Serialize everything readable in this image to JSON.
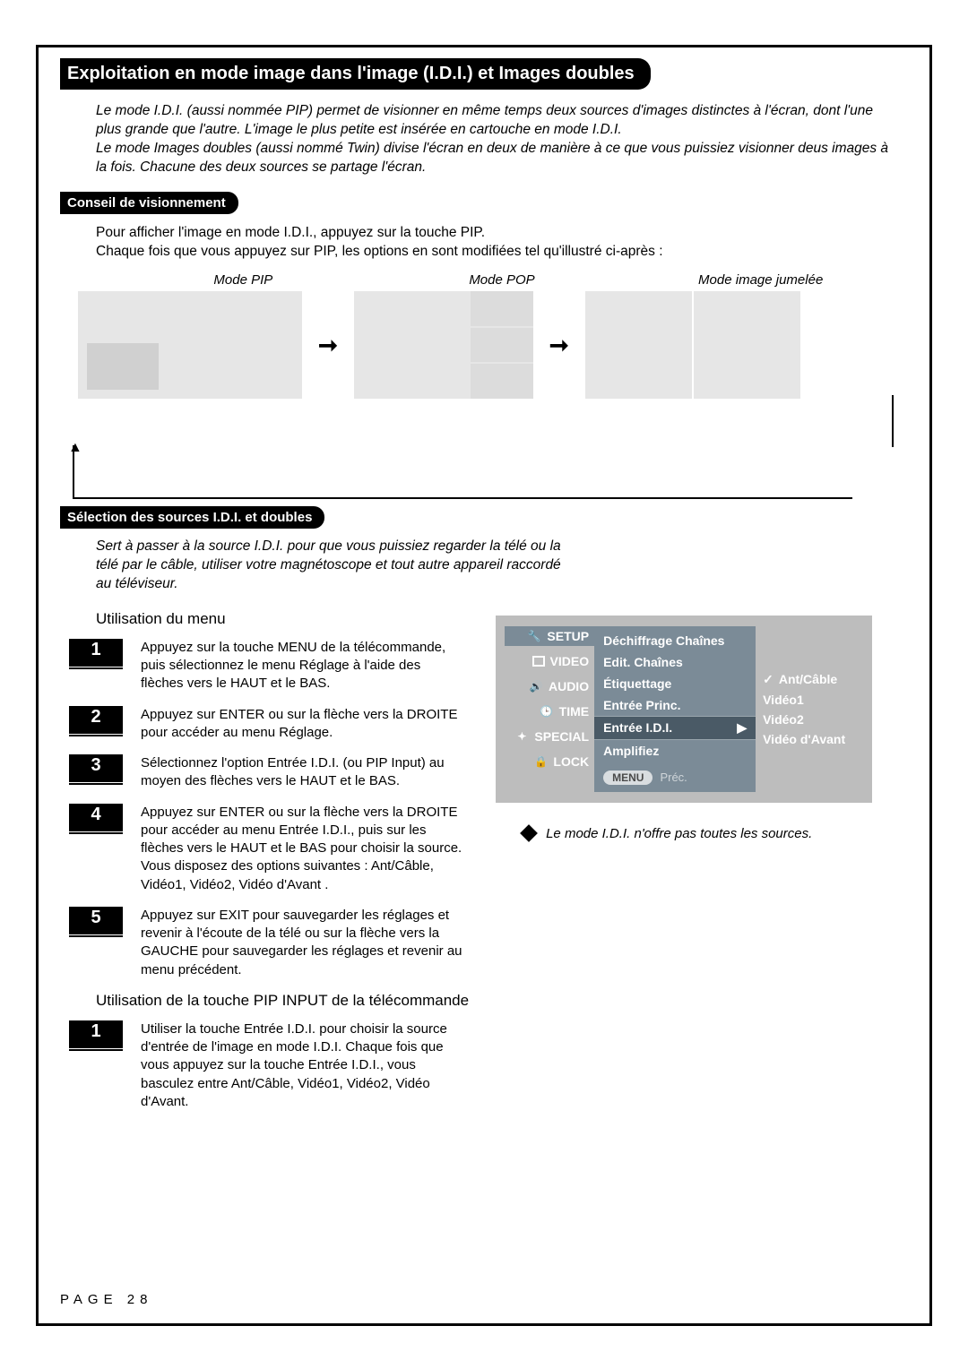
{
  "title": "Exploitation en mode image dans l'image (I.D.I.) et Images doubles",
  "intro": "Le mode I.D.I. (aussi nommée PIP) permet de visionner en même temps deux sources d'images distinctes à l'écran, dont l'une plus grande que l'autre. L'image le plus petite est insérée en cartouche en mode I.D.I.\nLe mode Images doubles (aussi nommé Twin) divise l'écran en deux de manière à ce que vous puissiez visionner deus images à la fois. Chacune des deux sources se partage l'écran.",
  "section_conseil": "Conseil de visionnement",
  "conseil_text": "Pour afficher l'image en mode I.D.I., appuyez sur la touche PIP.\nChaque fois que vous appuyez sur PIP, les options en sont modifiées tel qu'illustré ci-après :",
  "modes": {
    "pip": "Mode PIP",
    "pop": "Mode POP",
    "twin": "Mode image jumelée"
  },
  "section_selection": "Sélection des sources I.D.I. et doubles",
  "selection_intro": "Sert à passer à la source I.D.I. pour que vous puissiez regarder la télé ou la télé par le câble, utiliser votre magnétoscope  et tout autre appareil raccordé au téléviseur.",
  "util_menu_heading": "Utilisation du menu",
  "steps_menu": [
    "Appuyez sur la touche MENU de la télécommande, puis sélectionnez le menu Réglage à l'aide des flèches vers le HAUT et le BAS.",
    "Appuyez sur ENTER ou sur la flèche vers la DROITE pour accéder au menu Réglage.",
    "Sélectionnez l'option Entrée I.D.I. (ou PIP Input) au moyen des flèches vers le HAUT et le BAS.",
    "Appuyez sur ENTER ou sur la flèche vers la DROITE pour accéder au menu Entrée I.D.I., puis sur les flèches vers le HAUT et le BAS pour choisir la source. Vous disposez des options suivantes : Ant/Câble, Vidéo1, Vidéo2, Vidéo d'Avant .",
    "Appuyez sur EXIT pour sauvegarder les réglages et revenir à l'écoute de la télé ou sur la flèche vers la GAUCHE pour sauvegarder les réglages et revenir au menu précédent."
  ],
  "util_pip_heading": "Utilisation de la touche PIP INPUT de la télécommande",
  "steps_pip": [
    "Utiliser la touche Entrée I.D.I. pour choisir la source d'entrée de l'image en mode I.D.I. Chaque fois que vous appuyez sur la touche Entrée I.D.I., vous basculez entre Ant/Câble, Vidéo1, Vidéo2, Vidéo d'Avant."
  ],
  "osd": {
    "tabs": [
      "SETUP",
      "VIDEO",
      "AUDIO",
      "TIME",
      "SPECIAL",
      "LOCK"
    ],
    "items": [
      "Déchiffrage Chaînes",
      "Edit. Chaînes",
      "Étiquettage",
      "Entrée Princ.",
      "Entrée I.D.I.",
      "Amplifiez"
    ],
    "selected_item": "Entrée I.D.I.",
    "options": [
      "Ant/Câble",
      "Vidéo1",
      "Vidéo2",
      "Vidéo d'Avant"
    ],
    "selected_option": "Ant/Câble",
    "footer_menu": "MENU",
    "footer_prev": "Préc."
  },
  "note": "Le mode I.D.I. n'offre pas toutes les sources.",
  "page_label": "PAGE 28",
  "nums": {
    "n1": "1",
    "n2": "2",
    "n3": "3",
    "n4": "4",
    "n5": "5"
  }
}
